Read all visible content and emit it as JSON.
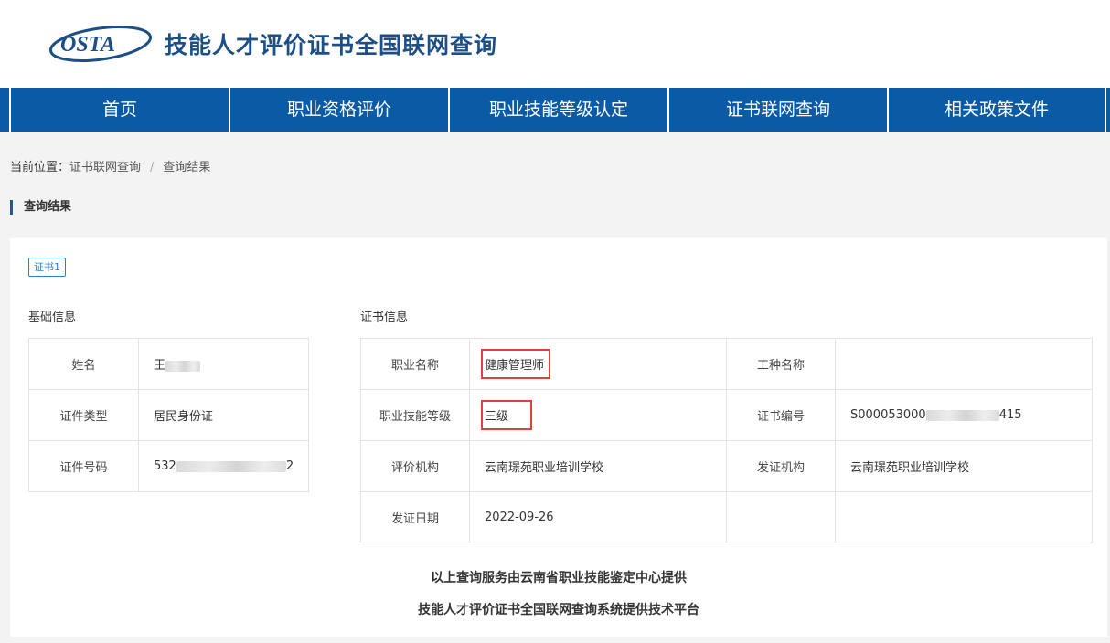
{
  "header": {
    "logo_text": "OSTA",
    "site_title": "技能人才评价证书全国联网查询"
  },
  "nav": {
    "items": [
      {
        "label": "首页"
      },
      {
        "label": "职业资格评价"
      },
      {
        "label": "职业技能等级认定"
      },
      {
        "label": "证书联网查询"
      },
      {
        "label": "相关政策文件"
      }
    ]
  },
  "breadcrumb": {
    "prefix": "当前位置：",
    "items": [
      "证书联网查询",
      "查询结果"
    ],
    "separator": "/"
  },
  "section_title": "查询结果",
  "certificate_tab": "证书1",
  "basic_info": {
    "title": "基础信息",
    "rows": [
      {
        "label": "姓名",
        "value": "王"
      },
      {
        "label": "证件类型",
        "value": "居民身份证"
      },
      {
        "label": "证件号码",
        "value": "532",
        "value_suffix": "2"
      }
    ]
  },
  "cert_info": {
    "title": "证书信息",
    "rows": [
      {
        "label1": "职业名称",
        "value1": "健康管理师",
        "label2": "工种名称",
        "value2": ""
      },
      {
        "label1": "职业技能等级",
        "value1": "三级",
        "label2": "证书编号",
        "value2": "S000053000",
        "value2_suffix": "415"
      },
      {
        "label1": "评价机构",
        "value1": "云南璟苑职业培训学校",
        "label2": "发证机构",
        "value2": "云南璟苑职业培训学校"
      },
      {
        "label1": "发证日期",
        "value1": "2022-09-26",
        "label2": "",
        "value2": ""
      }
    ]
  },
  "footer": {
    "line1": "以上查询服务由云南省职业技能鉴定中心提供",
    "line2": "技能人才评价证书全国联网查询系统提供技术平台"
  },
  "colors": {
    "nav_bg": "#0a5aa6",
    "title": "#1d4f86",
    "highlight_border": "#e0403a",
    "tab_border": "#2f7fc8"
  }
}
